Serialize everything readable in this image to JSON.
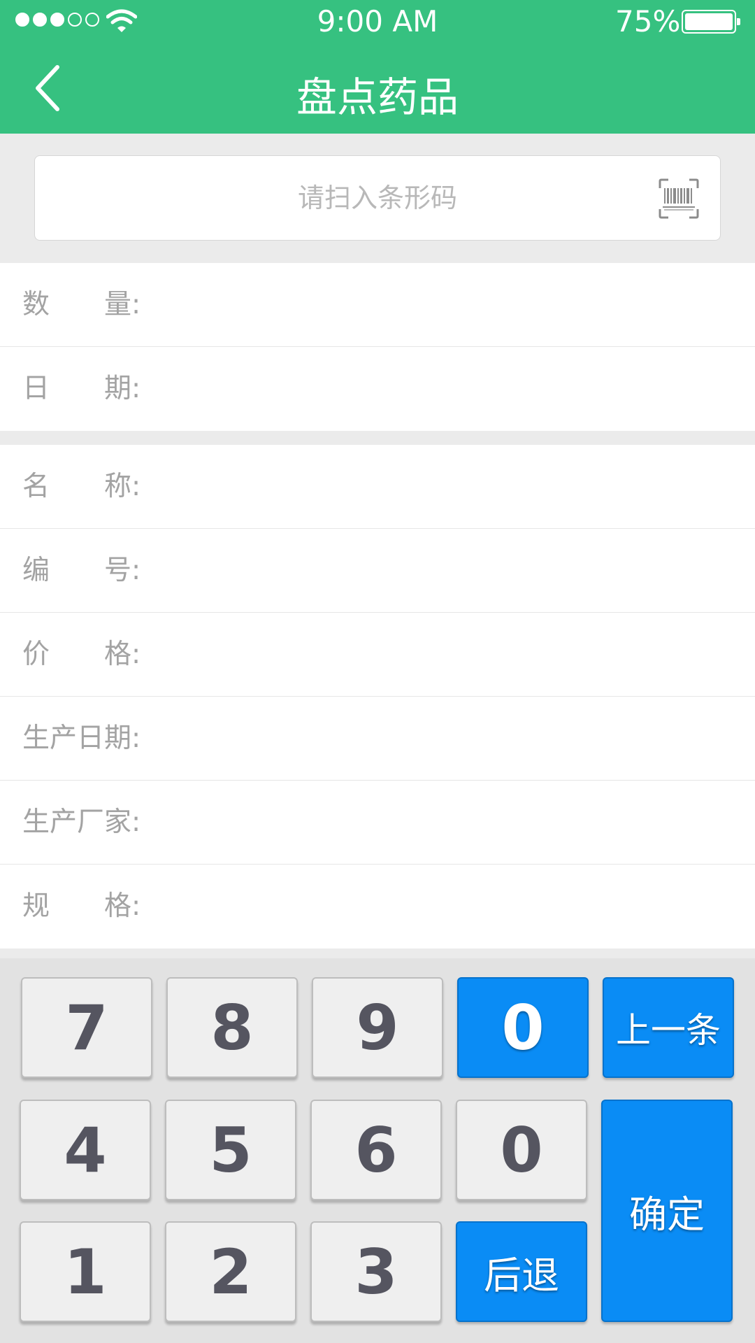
{
  "status_bar": {
    "time": "9:00 AM",
    "battery_percent": "75%",
    "signal_bars_filled": 3,
    "signal_bars_total": 5,
    "battery_level": 1.0
  },
  "header": {
    "title": "盘点药品"
  },
  "search": {
    "placeholder": "请扫入条形码",
    "value": ""
  },
  "section_top": {
    "rows": [
      {
        "label": "数　　量:",
        "value": ""
      },
      {
        "label": "日　　期:",
        "value": ""
      }
    ]
  },
  "section_details": {
    "rows": [
      {
        "label": "名　　称:",
        "value": ""
      },
      {
        "label": "编　　号:",
        "value": ""
      },
      {
        "label": "价　　格:",
        "value": ""
      },
      {
        "label": "生产日期:",
        "value": ""
      },
      {
        "label": "生产厂家:",
        "value": ""
      },
      {
        "label": "规　　格:",
        "value": ""
      }
    ]
  },
  "keypad": {
    "keys": {
      "k7": "7",
      "k8": "8",
      "k9": "9",
      "k0_top": "0",
      "prev": "上一条",
      "k4": "4",
      "k5": "5",
      "k6": "6",
      "k0": "0",
      "confirm": "确定",
      "k1": "1",
      "k2": "2",
      "k3": "3",
      "back": "后退"
    }
  },
  "colors": {
    "header": "#36c180",
    "key_blue": "#0a8cf5",
    "key_gray": "#efefef",
    "label_text": "#a3a3a3"
  }
}
